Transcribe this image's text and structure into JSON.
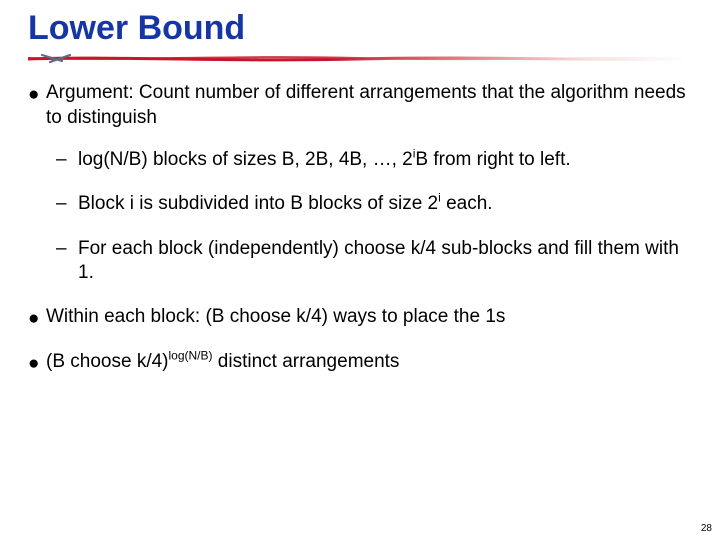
{
  "title": "Lower Bound",
  "rule_color_a": "#c8152b",
  "rule_color_b": "#f7e0e0",
  "mark_color": "#5c6b8a",
  "bullets": {
    "l1a": "Argument: Count number of different arrangements that the algorithm needs to distinguish",
    "l2a_pre": "log(N/B) blocks of sizes B, 2B, 4B, …, 2",
    "l2a_sup": "i",
    "l2a_post": "B from right to left.",
    "l2b_pre": "Block i is subdivided into B blocks of size 2",
    "l2b_sup": "i",
    "l2b_post": " each.",
    "l2c": "For each block (independently) choose k/4 sub-blocks and fill them with 1.",
    "l1b": "Within each block: (B choose k/4) ways to place the 1s",
    "l1c_pre": "(B choose k/4)",
    "l1c_sup": "log(N/B)",
    "l1c_post": " distinct arrangements"
  },
  "page_number": "28"
}
